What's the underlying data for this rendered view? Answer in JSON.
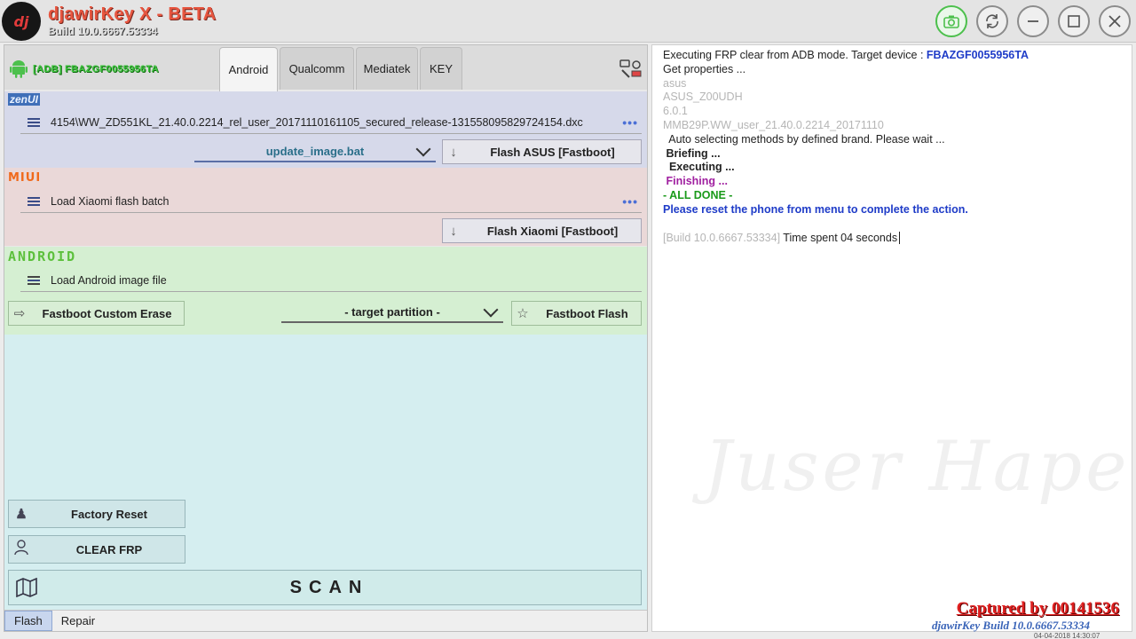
{
  "window": {
    "logo_text": "dj",
    "title": "djawirKey X - BETA",
    "build": "Build 10.0.6667.53334",
    "buttons": [
      "camera-icon",
      "refresh-icon",
      "minimize-icon",
      "maximize-icon",
      "close-icon"
    ]
  },
  "device": {
    "id_label": "[ADB] FBAZGF0055956TA"
  },
  "tabs": [
    "Android",
    "Qualcomm",
    "Mediatek",
    "KEY"
  ],
  "active_tab": "Android",
  "zenui": {
    "label": "zenUI",
    "file": "4154\\WW_ZD551KL_21.40.0.2214_rel_user_20171110161105_secured_release-131558095829724154.dxc",
    "more": "•••",
    "script_select": "update_image.bat",
    "flash_button": "Flash ASUS [Fastboot]"
  },
  "miui": {
    "label": "MIUI",
    "file": "Load Xiaomi flash batch",
    "more": "•••",
    "flash_button": "Flash Xiaomi [Fastboot]"
  },
  "android": {
    "label": "ANDROID",
    "file": "Load Android image file",
    "erase_button": "Fastboot Custom Erase",
    "partition_select": "- target partition -",
    "flash_button": "Fastboot Flash"
  },
  "actions": {
    "factory_reset": "Factory Reset",
    "clear_frp": "CLEAR FRP",
    "scan": "SCAN"
  },
  "bottom_tabs": [
    "Flash",
    "Repair"
  ],
  "log": {
    "line1_prefix": "Executing FRP clear from ADB mode. Target device : ",
    "line1_device": "FBAZGF0055956TA",
    "line2": " Get properties ...",
    "line3": "asus",
    "line4": "ASUS_Z00UDH",
    "line5": "6.0.1",
    "line6": "MMB29P.WW_user_21.40.0.2214_20171110",
    "line7": "  Auto selecting methods by defined brand. Please wait ...",
    "line8": " Briefing ...",
    "line9": "  Executing ...",
    "line10": " Finishing ...",
    "line11": "- ALL DONE -",
    "line12": "Please reset the phone from menu to complete the action.",
    "footer_build": "[Build 10.0.6667.53334]",
    "footer_time": " Time spent 04 seconds"
  },
  "watermark": "Juser Hape",
  "captured": "Captured by 00141536",
  "footer_build": "djawirKey Build 10.0.6667.53334",
  "footer_date": "04-04-2018 14:30:07"
}
